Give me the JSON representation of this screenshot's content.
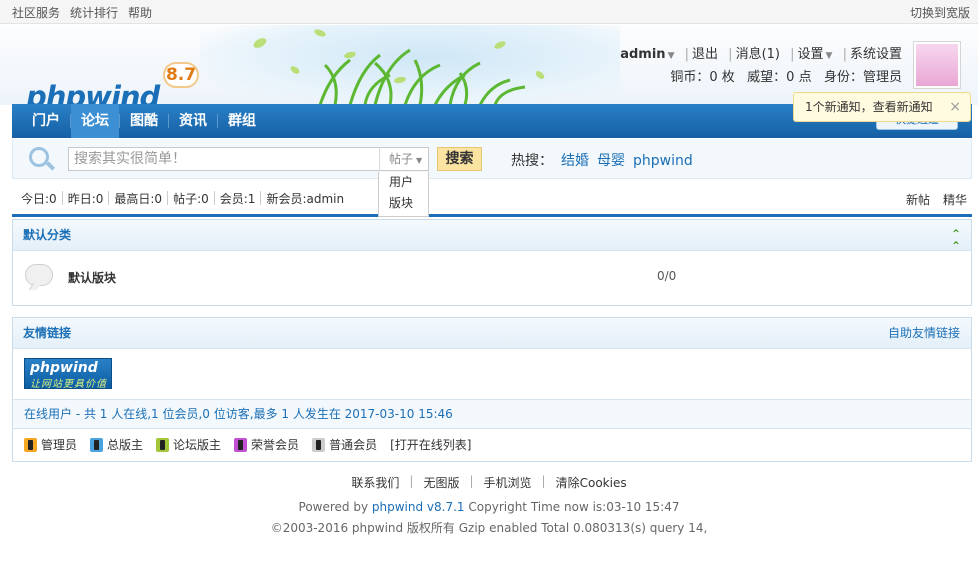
{
  "topbar": {
    "links": [
      "社区服务",
      "统计排行",
      "帮助"
    ],
    "switch_wide": "切换到宽版"
  },
  "brand": {
    "logo": "phpwind",
    "version": "8.7"
  },
  "user": {
    "name": "admin",
    "logout": "退出",
    "messages": "消息(1)",
    "settings": "设置",
    "system_settings": "系统设置",
    "copper": "铜币：0 枚",
    "prestige": "威望：0 点",
    "identity": "身份：管理员"
  },
  "notice": {
    "text": "1个新通知，",
    "link": "查看新通知",
    "close": "×"
  },
  "nav": {
    "items": [
      "门户",
      "论坛",
      "图酷",
      "资讯",
      "群组"
    ],
    "active": "论坛",
    "quick": "快捷通道"
  },
  "search": {
    "placeholder": "搜索其实很简单！",
    "type": "帖子",
    "options": [
      "用户",
      "版块"
    ],
    "button": "搜索",
    "hot_label": "热搜：",
    "hot_terms": [
      "结婚",
      "母婴",
      "phpwind"
    ]
  },
  "stats": {
    "items": [
      "今日:0",
      "昨日:0",
      "最高日:0",
      "帖子:0",
      "会员:1",
      "新会员:admin"
    ],
    "right": [
      "新帖",
      "精华"
    ]
  },
  "category": {
    "title": "默认分类",
    "forum_name": "默认版块",
    "forum_count": "0/0"
  },
  "friend_links": {
    "title": "友情链接",
    "self_help": "自助友情链接",
    "logo_text": "phpwind",
    "logo_sub": "让网站更具价值"
  },
  "online": {
    "text": "在线用户 - 共 1 人在线,1 位会员,0 位访客,最多 1 人发生在 2017-03-10 15:46"
  },
  "legend": {
    "items": [
      {
        "label": "管理员",
        "color": "#f5a623"
      },
      {
        "label": "总版主",
        "color": "#4aa3df"
      },
      {
        "label": "论坛版主",
        "color": "#a4c639"
      },
      {
        "label": "荣誉会员",
        "color": "#c14fd1"
      },
      {
        "label": "普通会员",
        "color": "#cccccc"
      }
    ],
    "open_list": "[打开在线列表]"
  },
  "footer": {
    "links": [
      "联系我们",
      "无图版",
      "手机浏览",
      "清除Cookies"
    ],
    "powered_prefix": "Powered by ",
    "powered_link": "phpwind v8.7.1",
    "powered_suffix": " Copyright Time now is:03-10 15:47",
    "copyright": "©2003-2016 phpwind 版权所有 Gzip enabled Total 0.080313(s) query 14,"
  }
}
